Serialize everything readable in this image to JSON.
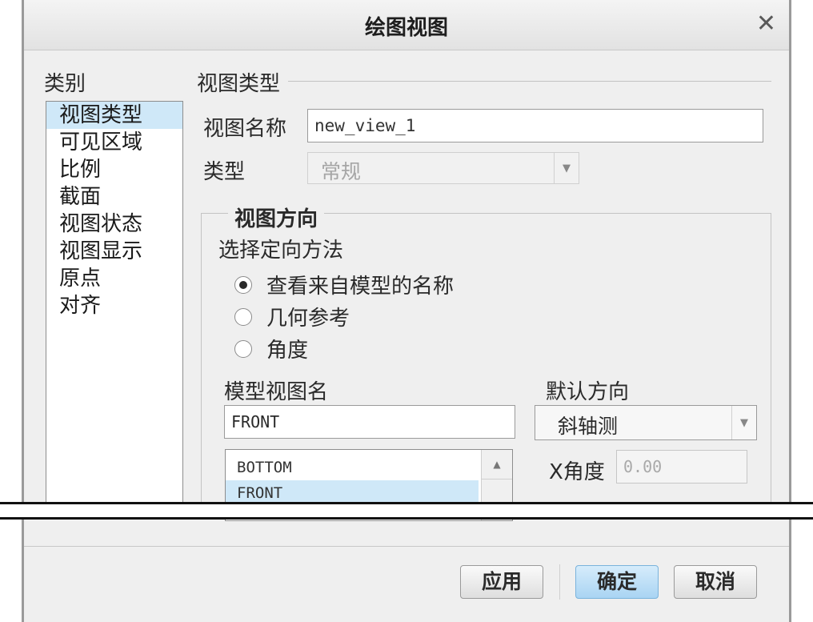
{
  "dialog": {
    "title": "绘图视图",
    "close_glyph": "✕"
  },
  "categories": {
    "heading": "类别",
    "items": [
      "视图类型",
      "可见区域",
      "比例",
      "截面",
      "视图状态",
      "视图显示",
      "原点",
      "对齐"
    ],
    "selected_index": 0
  },
  "view_type": {
    "section_title": "视图类型",
    "name_label": "视图名称",
    "name_value": "new_view_1",
    "type_label": "类型",
    "type_value": "常规",
    "type_disabled": true
  },
  "orientation": {
    "group_title": "视图方向",
    "method_label": "选择定向方法",
    "options": [
      "查看来自模型的名称",
      "几何参考",
      "角度"
    ],
    "selected_option_index": 0,
    "model_view_name_label": "模型视图名",
    "model_view_name_value": "FRONT",
    "model_views": [
      "BOTTOM",
      "FRONT"
    ],
    "selected_model_view_index": 1,
    "default_orientation_label": "默认方向",
    "default_orientation_value": "斜轴测",
    "x_angle_label": "X角度",
    "x_angle_value": "0.00"
  },
  "footer": {
    "apply_label": "应用",
    "ok_label": "确定",
    "cancel_label": "取消"
  },
  "icons": {
    "close": "close-icon",
    "dropdown": "chevron-down-icon",
    "scroll_up": "scroll-up-arrow-icon"
  },
  "colors": {
    "selection": "#cfe8f8",
    "primary_button": "#a9d4f3",
    "dialog_bg": "#efefef"
  }
}
